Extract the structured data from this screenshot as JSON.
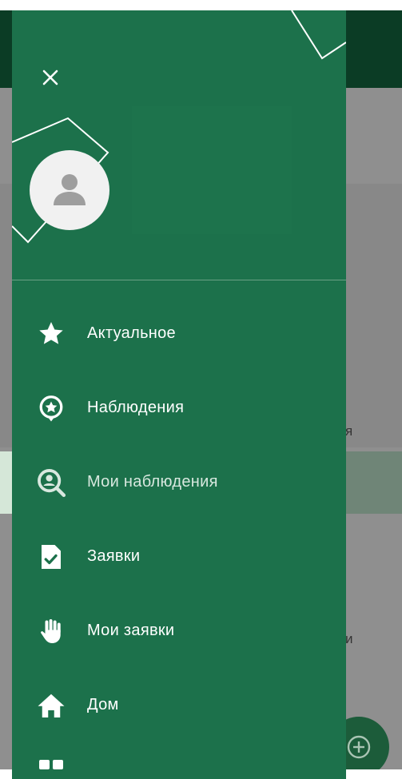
{
  "background": {
    "fragment_1": "я",
    "fragment_2": "и",
    "fab_icon": "add-circle-icon"
  },
  "drawer": {
    "close_icon": "close-icon",
    "avatar_icon": "person-icon",
    "menu": [
      {
        "label": "Актуальное",
        "icon": "star-icon"
      },
      {
        "label": "Наблюдения",
        "icon": "star-badge-icon"
      },
      {
        "label": "Мои наблюдения",
        "icon": "search-person-icon"
      },
      {
        "label": "Заявки",
        "icon": "document-check-icon"
      },
      {
        "label": "Мои заявки",
        "icon": "hand-icon"
      },
      {
        "label": "Дом",
        "icon": "home-icon"
      }
    ]
  },
  "colors": {
    "drawer": "#1c714b",
    "app_bar": "#0b3c25",
    "highlight": "#d5e7d8"
  }
}
